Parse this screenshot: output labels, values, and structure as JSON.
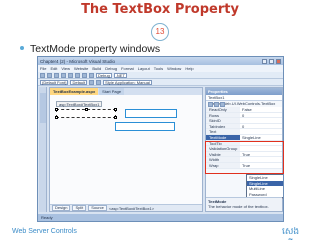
{
  "slide": {
    "title": "The TextBox Property",
    "page_number": "13",
    "bullet": "TextMode property windows",
    "footer_left": "Web Server Controls",
    "footer_right": "សេង ស្រ៊ីយន"
  },
  "window": {
    "title": "Chapter4 (2) - Microsoft Visual Studio",
    "menu": [
      "File",
      "Edit",
      "View",
      "Website",
      "Build",
      "Debug",
      "Format",
      "Layout",
      "Tools",
      "Window",
      "Help"
    ],
    "toolbar_debug": "Debug",
    "toolbar_framework": ".NET",
    "toolbar_font": "(Default Font)",
    "toolbar_size": "Default",
    "toolbar_style": "Style Application: Manual",
    "doc_tabs": [
      "TextBoxExample.aspx",
      "Start Page"
    ],
    "tag_label": "asp:TextBox#TextBox1",
    "design_buttons": [
      "Design",
      "Split",
      "Source"
    ],
    "breadcrumb": "<asp:TextBox#TextBox1>",
    "status": "Ready"
  },
  "properties": {
    "header": "Properties",
    "object": "TextBox1 System.Web.UI.WebControls.TextBox",
    "rows": [
      {
        "name": "ReadOnly",
        "value": "False"
      },
      {
        "name": "Rows",
        "value": "0"
      },
      {
        "name": "SkinID",
        "value": ""
      },
      {
        "name": "TabIndex",
        "value": "0"
      },
      {
        "name": "Text",
        "value": ""
      },
      {
        "name": "TextMode",
        "value": "SingleLine"
      },
      {
        "name": "ToolTip",
        "value": ""
      },
      {
        "name": "ValidationGroup",
        "value": ""
      },
      {
        "name": "Visible",
        "value": "True"
      },
      {
        "name": "Width",
        "value": ""
      },
      {
        "name": "Wrap",
        "value": "True"
      }
    ],
    "dropdown_options": [
      "SingleLine",
      "SingleLine",
      "MultiLine",
      "Password"
    ],
    "dropdown_selected": "SingleLine",
    "desc_title": "TextMode",
    "desc_text": "The behavior mode of the textbox."
  },
  "colors": {
    "title": "#c0392b",
    "highlight": "#e0301e",
    "accent": "#3d8dc8"
  }
}
